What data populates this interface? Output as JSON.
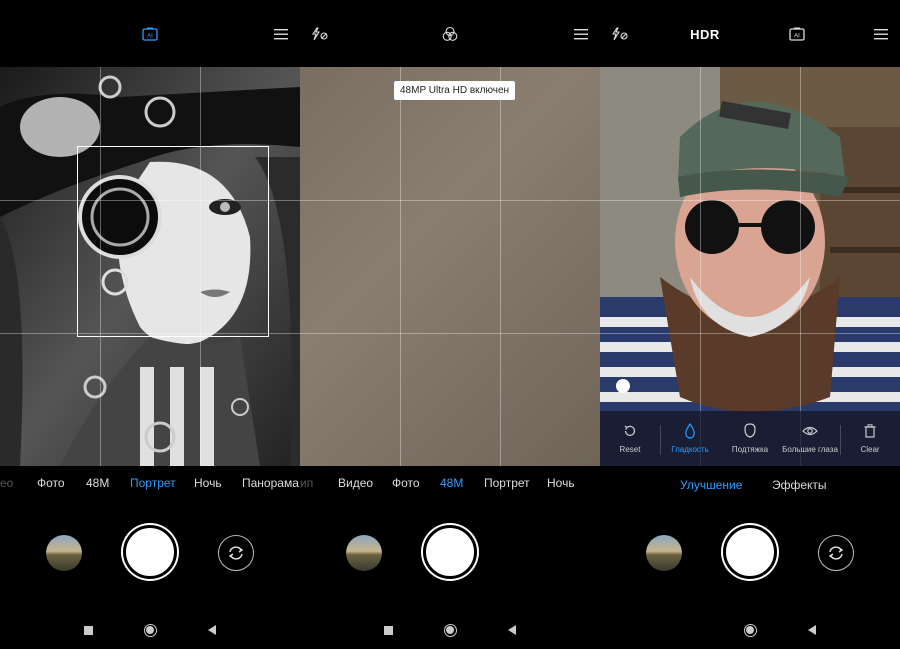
{
  "panel1": {
    "topbar": {
      "ai_icon": "ai-scene-icon",
      "menu_icon": "menu-icon",
      "ai_label": "AI"
    },
    "modes": [
      {
        "label": "ео",
        "state": "faded"
      },
      {
        "label": "Фото",
        "state": "normal"
      },
      {
        "label": "48M",
        "state": "normal"
      },
      {
        "label": "Портрет",
        "state": "active"
      },
      {
        "label": "Ночь",
        "state": "normal"
      },
      {
        "label": "Панорама",
        "state": "normal"
      }
    ]
  },
  "panel2": {
    "topbar": {
      "flash_icon": "flash-off-icon",
      "filters_icon": "filters-icon",
      "menu_icon": "menu-icon"
    },
    "toast": "48MP Ultra HD включен",
    "modes": [
      {
        "label": "ип",
        "state": "faded"
      },
      {
        "label": "Видео",
        "state": "normal"
      },
      {
        "label": "Фото",
        "state": "normal"
      },
      {
        "label": "48M",
        "state": "active"
      },
      {
        "label": "Портрет",
        "state": "normal"
      },
      {
        "label": "Ночь",
        "state": "normal"
      }
    ]
  },
  "panel3": {
    "topbar": {
      "flash_icon": "flash-off-icon",
      "hdr_label": "HDR",
      "ai_icon": "ai-scene-icon",
      "ai_label": "AI",
      "menu_icon": "menu-icon"
    },
    "beauty": [
      {
        "label": "Reset",
        "icon": "reset-icon",
        "active": false
      },
      {
        "label": "Гладкость",
        "icon": "drop-icon",
        "active": true
      },
      {
        "label": "Подтяжка",
        "icon": "face-icon",
        "active": false
      },
      {
        "label": "Большие глаза",
        "icon": "eye-icon",
        "active": false
      },
      {
        "label": "Clear",
        "icon": "trash-icon",
        "active": false
      }
    ],
    "tabs": [
      {
        "label": "Улучшение",
        "active": true
      },
      {
        "label": "Эффекты",
        "active": false
      }
    ]
  },
  "colors": {
    "accent": "#2f9bff",
    "background": "#000000"
  }
}
